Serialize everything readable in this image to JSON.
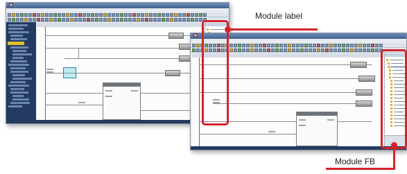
{
  "callouts": {
    "module_label": "Module label",
    "module_fb": "Module FB"
  },
  "colors": {
    "callout_red": "#d4232b",
    "navigator_bg": "#233a63",
    "title_bar": "#3f628f"
  },
  "window_front": {
    "icons": [
      "minimize-icon",
      "maximize-icon",
      "close-icon"
    ]
  },
  "window_back": {
    "icons": [
      "minimize-icon",
      "maximize-icon",
      "close-icon"
    ]
  }
}
